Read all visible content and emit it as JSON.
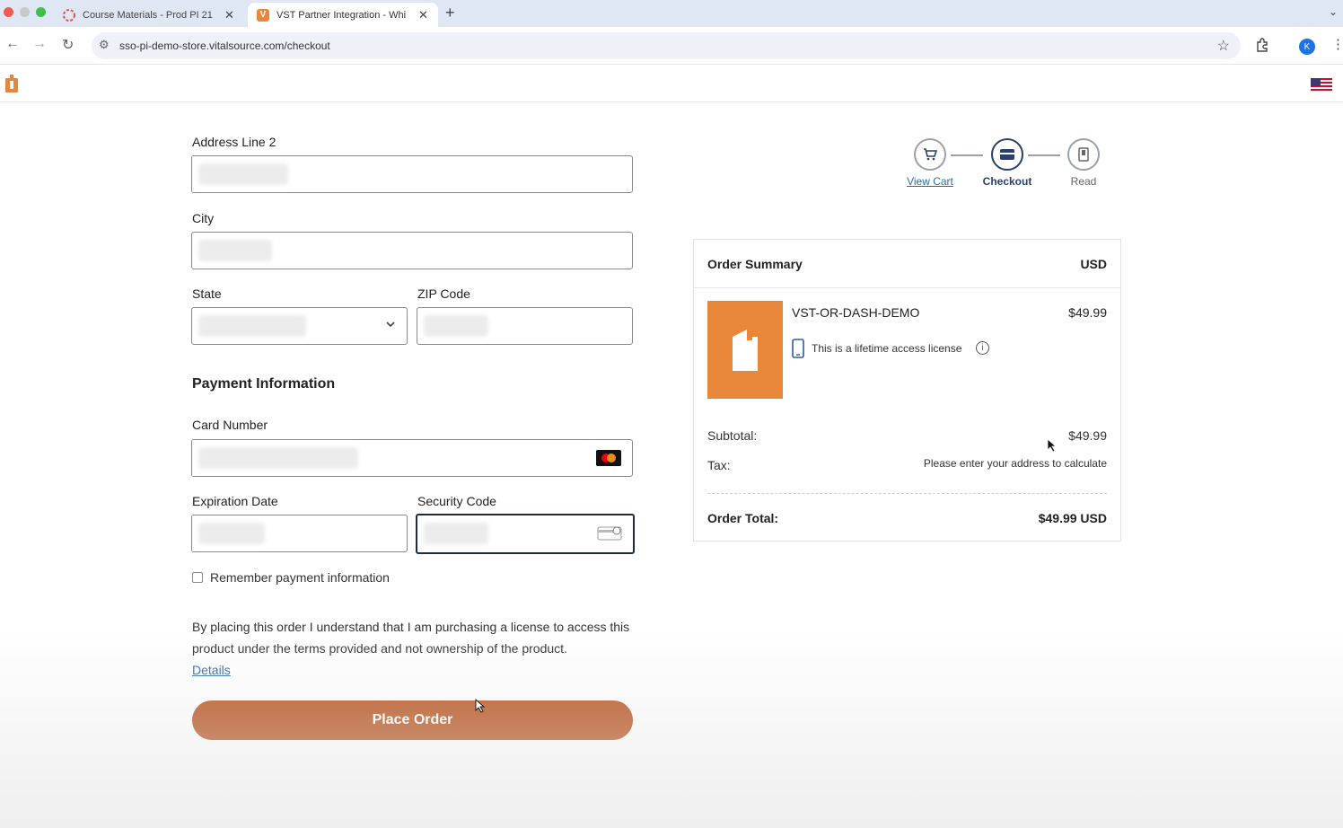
{
  "browser": {
    "tabs": [
      {
        "title": "Course Materials - Prod PI 21",
        "active": false
      },
      {
        "title": "VST Partner Integration - Whi",
        "active": true
      }
    ],
    "url": "sso-pi-demo-store.vitalsource.com/checkout",
    "profile_initial": "K"
  },
  "form": {
    "address2_label": "Address Line 2",
    "city_label": "City",
    "state_label": "State",
    "zip_label": "ZIP Code",
    "payment_title": "Payment Information",
    "card_label": "Card Number",
    "expiration_label": "Expiration Date",
    "security_label": "Security Code",
    "remember_label": "Remember payment information",
    "terms_text": "By placing this order I understand that I am purchasing a license to access this product under the terms provided and not ownership of the product.",
    "details_link": "Details",
    "place_order": "Place Order"
  },
  "stepper": {
    "steps": [
      {
        "label": "View Cart",
        "state": "link"
      },
      {
        "label": "Checkout",
        "state": "active"
      },
      {
        "label": "Read",
        "state": "upcoming"
      }
    ]
  },
  "summary": {
    "title": "Order Summary",
    "currency": "USD",
    "product_name": "VST-OR-DASH-DEMO",
    "product_price": "$49.99",
    "license_text": "This is a lifetime access license",
    "subtotal_label": "Subtotal:",
    "subtotal_value": "$49.99",
    "tax_label": "Tax:",
    "tax_value": "Please enter your address to calculate",
    "total_label": "Order Total:",
    "total_value": "$49.99 USD"
  },
  "colors": {
    "accent_button": "#b8531f",
    "thumbnail": "#e8873a",
    "link": "#2e6aa6",
    "stepper_active": "#2b3f6e"
  }
}
